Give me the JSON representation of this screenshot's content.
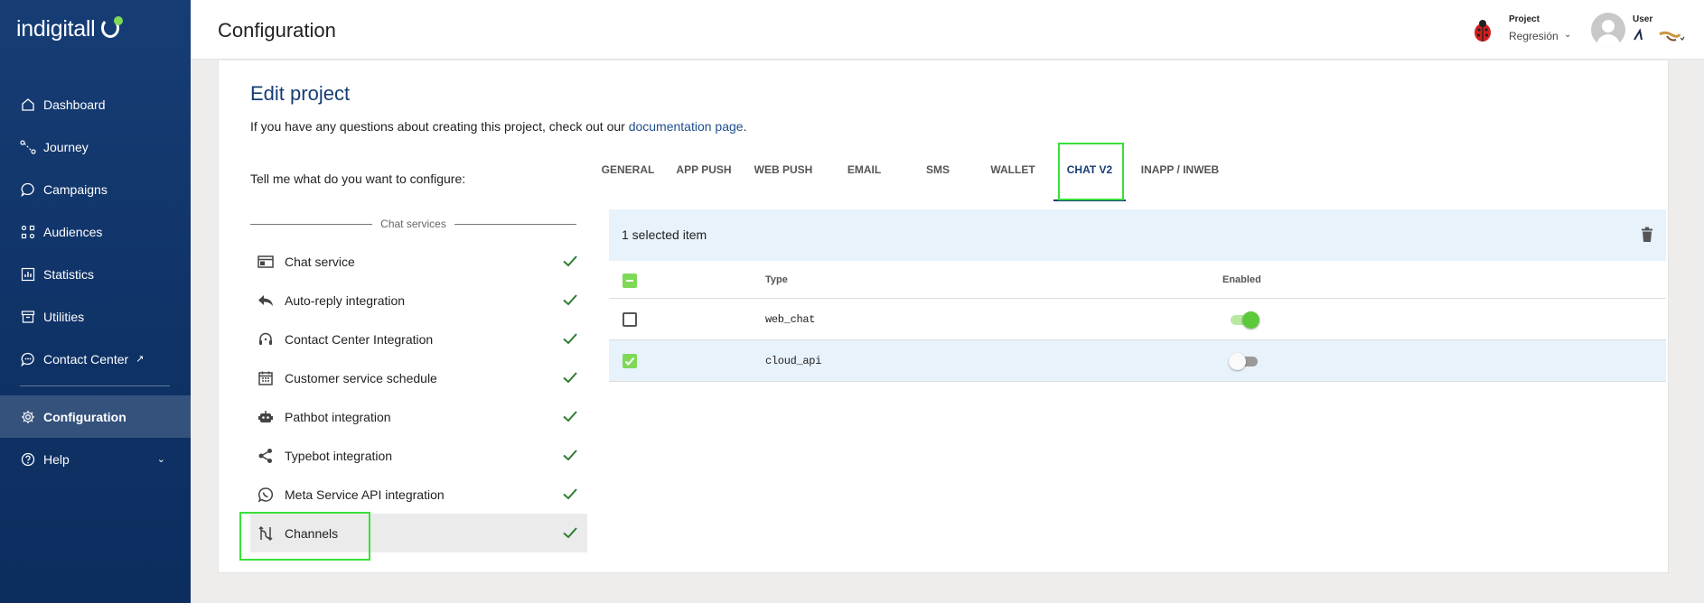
{
  "app": {
    "logo": "indigitall",
    "brand_color": "#163d75",
    "accent_color": "#7ed957"
  },
  "sidebar": {
    "items": [
      {
        "label": "Dashboard",
        "icon": "home-icon"
      },
      {
        "label": "Journey",
        "icon": "journey-icon"
      },
      {
        "label": "Campaigns",
        "icon": "chat-bubble-icon"
      },
      {
        "label": "Audiences",
        "icon": "audiences-icon"
      },
      {
        "label": "Statistics",
        "icon": "statistics-icon"
      },
      {
        "label": "Utilities",
        "icon": "archive-icon"
      },
      {
        "label": "Contact Center",
        "icon": "chat-dots-icon",
        "external": "↗"
      },
      {
        "label": "Configuration",
        "icon": "gear-icon",
        "active": true
      },
      {
        "label": "Help",
        "icon": "help-icon",
        "chevron": "⌄"
      }
    ]
  },
  "header": {
    "title": "Configuration",
    "project_label": "Project",
    "project_value": "Regresión",
    "project_chevron": "⌄",
    "user_label": "User"
  },
  "main": {
    "title": "Edit project",
    "intro_text": "If you have any questions about creating this project, check out our ",
    "intro_link": "documentation page",
    "intro_end": ".",
    "tell_label": "Tell me what do you want to configure:",
    "section_header": "Chat services",
    "menu": [
      {
        "label": "Chat service",
        "icon": "browser-window-icon"
      },
      {
        "label": "Auto-reply integration",
        "icon": "reply-icon"
      },
      {
        "label": "Contact Center Integration",
        "icon": "headset-icon"
      },
      {
        "label": "Customer service schedule",
        "icon": "calendar-icon"
      },
      {
        "label": "Pathbot integration",
        "icon": "robot-icon"
      },
      {
        "label": "Typebot integration",
        "icon": "share-icon"
      },
      {
        "label": "Meta Service API integration",
        "icon": "whatsapp-icon"
      },
      {
        "label": "Channels",
        "icon": "channels-icon",
        "selected": true
      }
    ],
    "tabs": [
      {
        "label": "GENERAL"
      },
      {
        "label": "APP PUSH"
      },
      {
        "label": "WEB PUSH"
      },
      {
        "label": "EMAIL"
      },
      {
        "label": "SMS"
      },
      {
        "label": "WALLET"
      },
      {
        "label": "CHAT V2",
        "active": true
      },
      {
        "label": "INAPP / INWEB"
      }
    ],
    "table": {
      "selected_text": "1 selected item",
      "col_type": "Type",
      "col_enabled": "Enabled",
      "rows": [
        {
          "type": "web_chat",
          "checked": false,
          "enabled": true
        },
        {
          "type": "cloud_api",
          "checked": true,
          "enabled": false
        }
      ]
    }
  }
}
